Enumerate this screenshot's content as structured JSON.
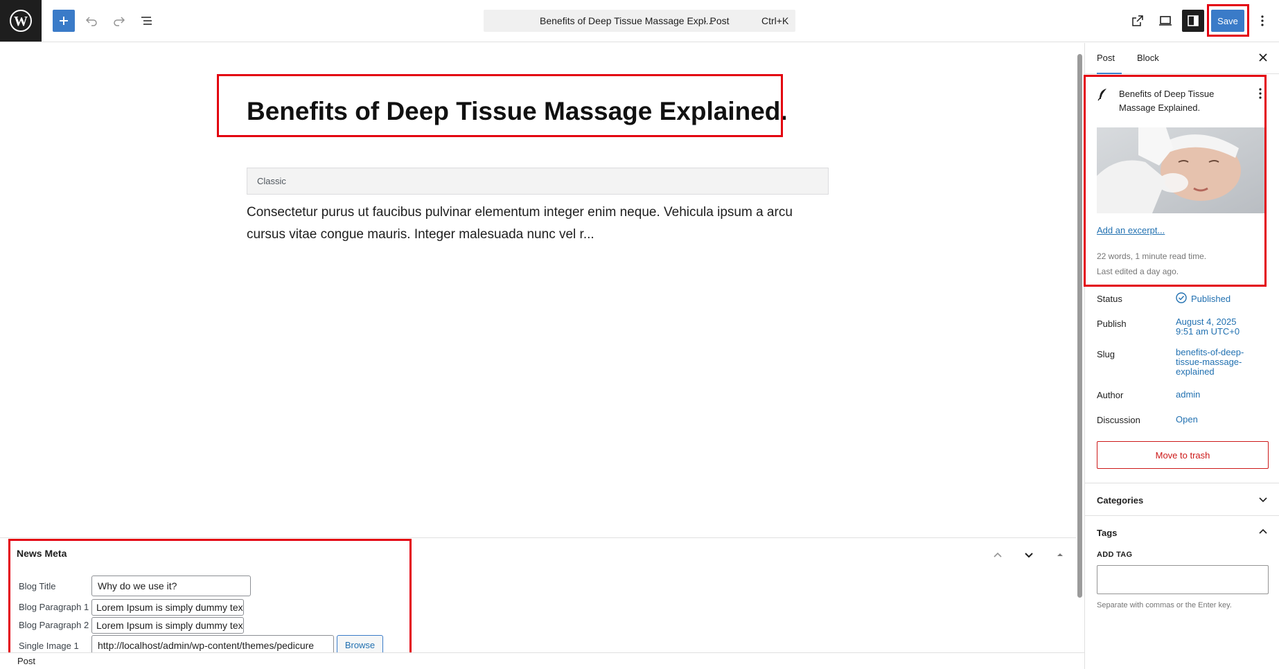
{
  "topbar": {
    "command_title": "Benefits of Deep Tissue Massage Expl...",
    "command_type": "· Post",
    "command_shortcut": "Ctrl+K",
    "save_label": "Save"
  },
  "editor": {
    "post_title": "Benefits of Deep Tissue Massage Explained.",
    "classic_label": "Classic",
    "body_text": "Consectetur purus ut faucibus pulvinar elementum integer enim neque. Vehicula ipsum a arcu cursus vitae congue mauris. Integer malesuada nunc vel r..."
  },
  "metabox": {
    "heading": "News Meta",
    "fields": {
      "blog_title_label": "Blog Title",
      "blog_title_value": "Why do we use it?",
      "para1_label": "Blog Paragraph 1",
      "para1_value": "Lorem Ipsum is simply dummy tex",
      "para2_label": "Blog Paragraph 2",
      "para2_value": "Lorem Ipsum is simply dummy tex",
      "image1_label": "Single Image 1",
      "image1_value": "http://localhost/admin/wp-content/themes/pedicure",
      "browse_label": "Browse"
    }
  },
  "footer": {
    "breadcrumb": "Post"
  },
  "sidebar": {
    "tabs": [
      "Post",
      "Block"
    ],
    "card_title": "Benefits of Deep Tissue Massage Explained.",
    "excerpt_link": "Add an excerpt...",
    "stats_words": "22 words, 1 minute read time.",
    "stats_edited": "Last edited a day ago.",
    "rows": {
      "status_label": "Status",
      "status_value": "Published",
      "publish_label": "Publish",
      "publish_value": "August 4, 2025\n9:51 am UTC+0",
      "slug_label": "Slug",
      "slug_value": "benefits-of-deep-\ntissue-massage-\nexplained",
      "author_label": "Author",
      "author_value": "admin",
      "discussion_label": "Discussion",
      "discussion_value": "Open"
    },
    "trash_label": "Move to trash",
    "categories_label": "Categories",
    "tags_label": "Tags",
    "add_tag_label": "ADD TAG",
    "tag_help": "Separate with commas or the Enter key."
  },
  "colors": {
    "accent": "#3a7bc8",
    "link": "#2271b1",
    "highlight": "#e3000f",
    "danger": "#cc1818"
  }
}
